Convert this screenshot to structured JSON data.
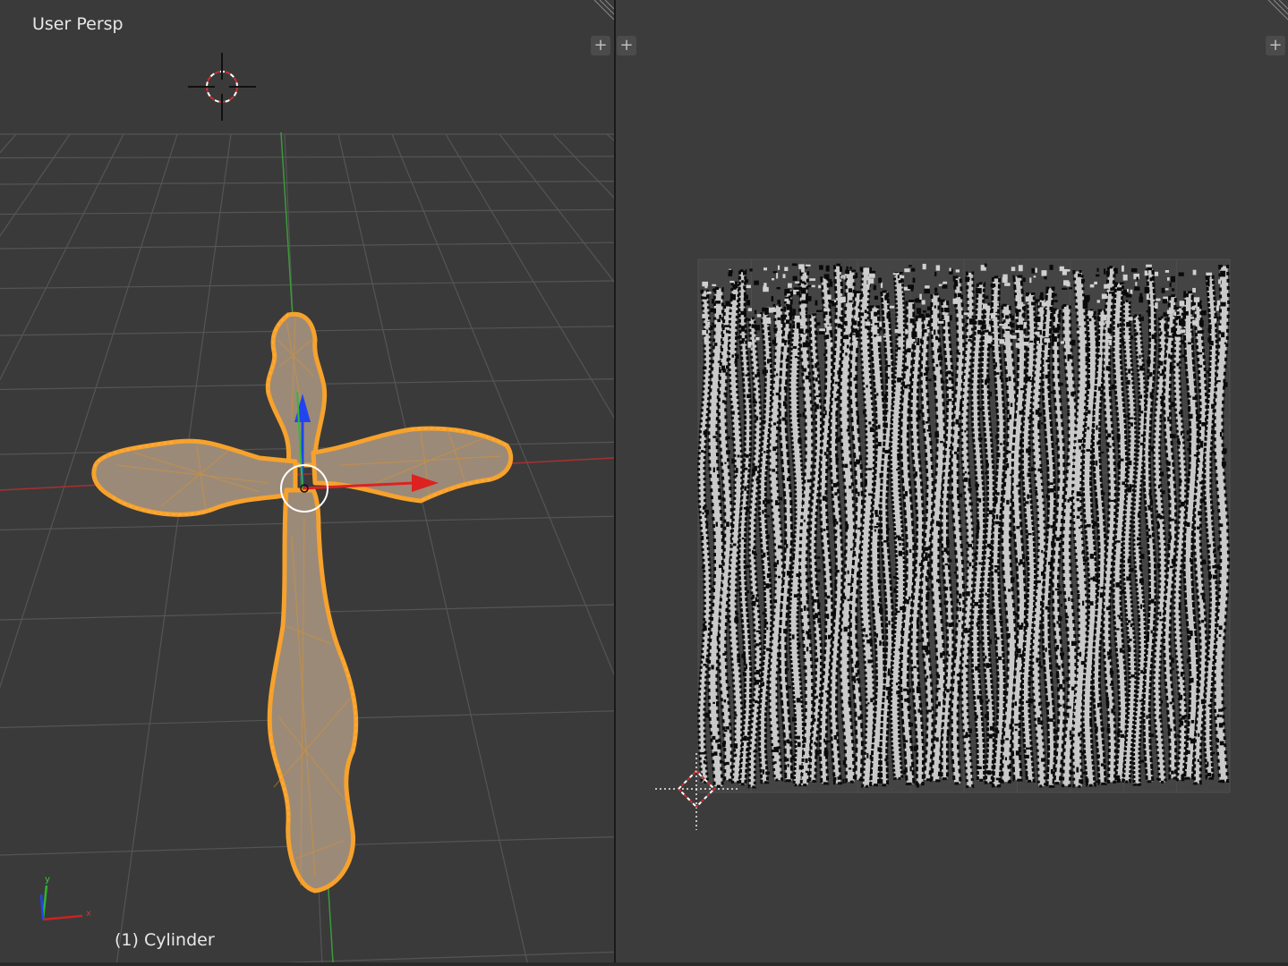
{
  "viewport": {
    "view_label": "User Persp",
    "object_label": "(1) Cylinder",
    "axis_labels": {
      "x": "x",
      "y": "y"
    }
  },
  "icons": {
    "plus": "+",
    "cursor": "3d-cursor-icon",
    "corner": "area-split-corner-icon"
  },
  "colors": {
    "background": "#3a3a3a",
    "grid": "#555555",
    "x_axis": "#b03030",
    "y_axis": "#3a9a3a",
    "selection_orange": "#f7a22c",
    "uv_island_light": "#c9c9c9",
    "uv_island_dark": "#0a0a0a"
  }
}
